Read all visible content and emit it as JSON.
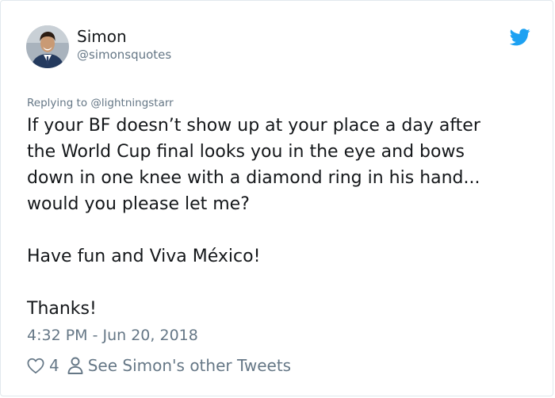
{
  "user": {
    "name": "Simon",
    "handle": "@simonsquotes"
  },
  "reply": {
    "prefix": "Replying to",
    "target": "@lightningstarr"
  },
  "tweet": {
    "lines": [
      "If your BF doesn’t show up at your place a day after",
      "the World Cup final looks you in the eye and bows",
      "down in one knee with a diamond ring in his hand...",
      "would you please let me?",
      "",
      "Have fun and Viva México!",
      "",
      "Thanks!"
    ]
  },
  "meta": {
    "timestamp": "4:32 PM - Jun 20, 2018"
  },
  "actions": {
    "like_count": "4",
    "other_tweets_label": "See Simon's other Tweets"
  },
  "colors": {
    "twitter_blue": "#1da1f2",
    "secondary_text": "#657786",
    "primary_text": "#14171a"
  },
  "icons": {
    "brand": "twitter-bird-icon",
    "like": "heart-icon",
    "profile": "person-icon"
  }
}
